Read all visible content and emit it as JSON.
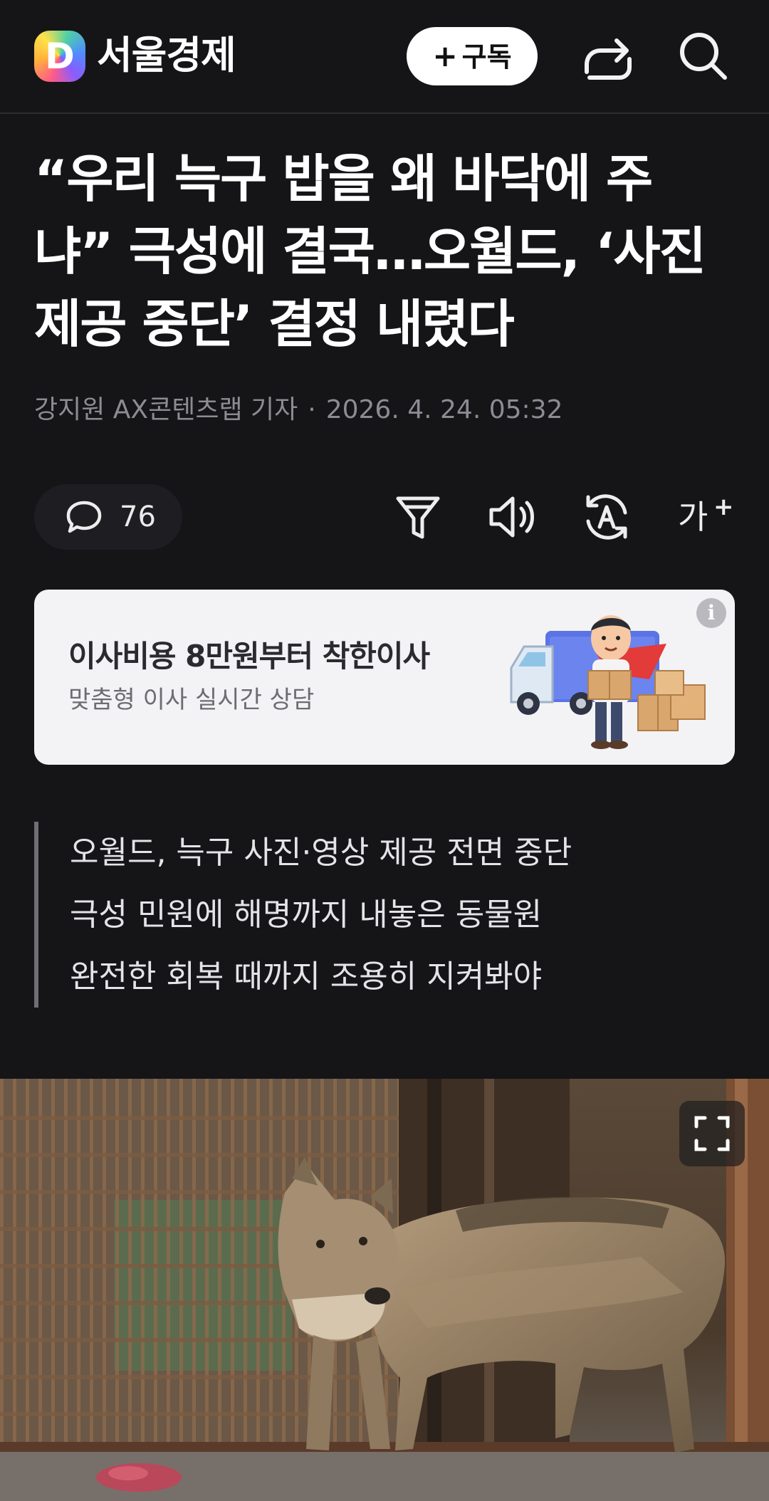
{
  "header": {
    "logo_letter": "D",
    "press_name": "서울경제",
    "subscribe_plus": "+",
    "subscribe_label": "구독"
  },
  "article": {
    "headline_lines": [
      "“우리 늑구 밥을 왜 바닥에 주",
      "냐” 극성에 결국…오월드, ‘사진",
      "제공 중단’ 결정 내렸다"
    ],
    "author": "강지원 AX콘텐츠랩 기자",
    "separator": "·",
    "datetime": "2026. 4. 24. 05:32"
  },
  "toolbar": {
    "comment_count": "76",
    "font_glyph": "가",
    "font_plus": "+"
  },
  "ad": {
    "title": "이사비용 8만원부터 착한이사",
    "subtitle": "맞춤형 이사 실시간 상담",
    "info_glyph": "i"
  },
  "summary": {
    "lines": [
      "오월드, 늑구 사진·영상 제공 전면 중단",
      "극성 민원에 해명까지 내놓은 동물원",
      "완전한 회복 때까지 조용히 지켜봐야"
    ]
  },
  "icons": {
    "share": "share-icon",
    "search": "search-icon",
    "comment": "comment-icon",
    "filter": "filter-icon",
    "tts": "speaker-icon",
    "translate": "translate-icon",
    "expand": "expand-icon"
  },
  "colors": {
    "background": "#151518",
    "text": "#ffffff",
    "muted": "#8c8c92",
    "ad_background": "#f3f3f5"
  }
}
